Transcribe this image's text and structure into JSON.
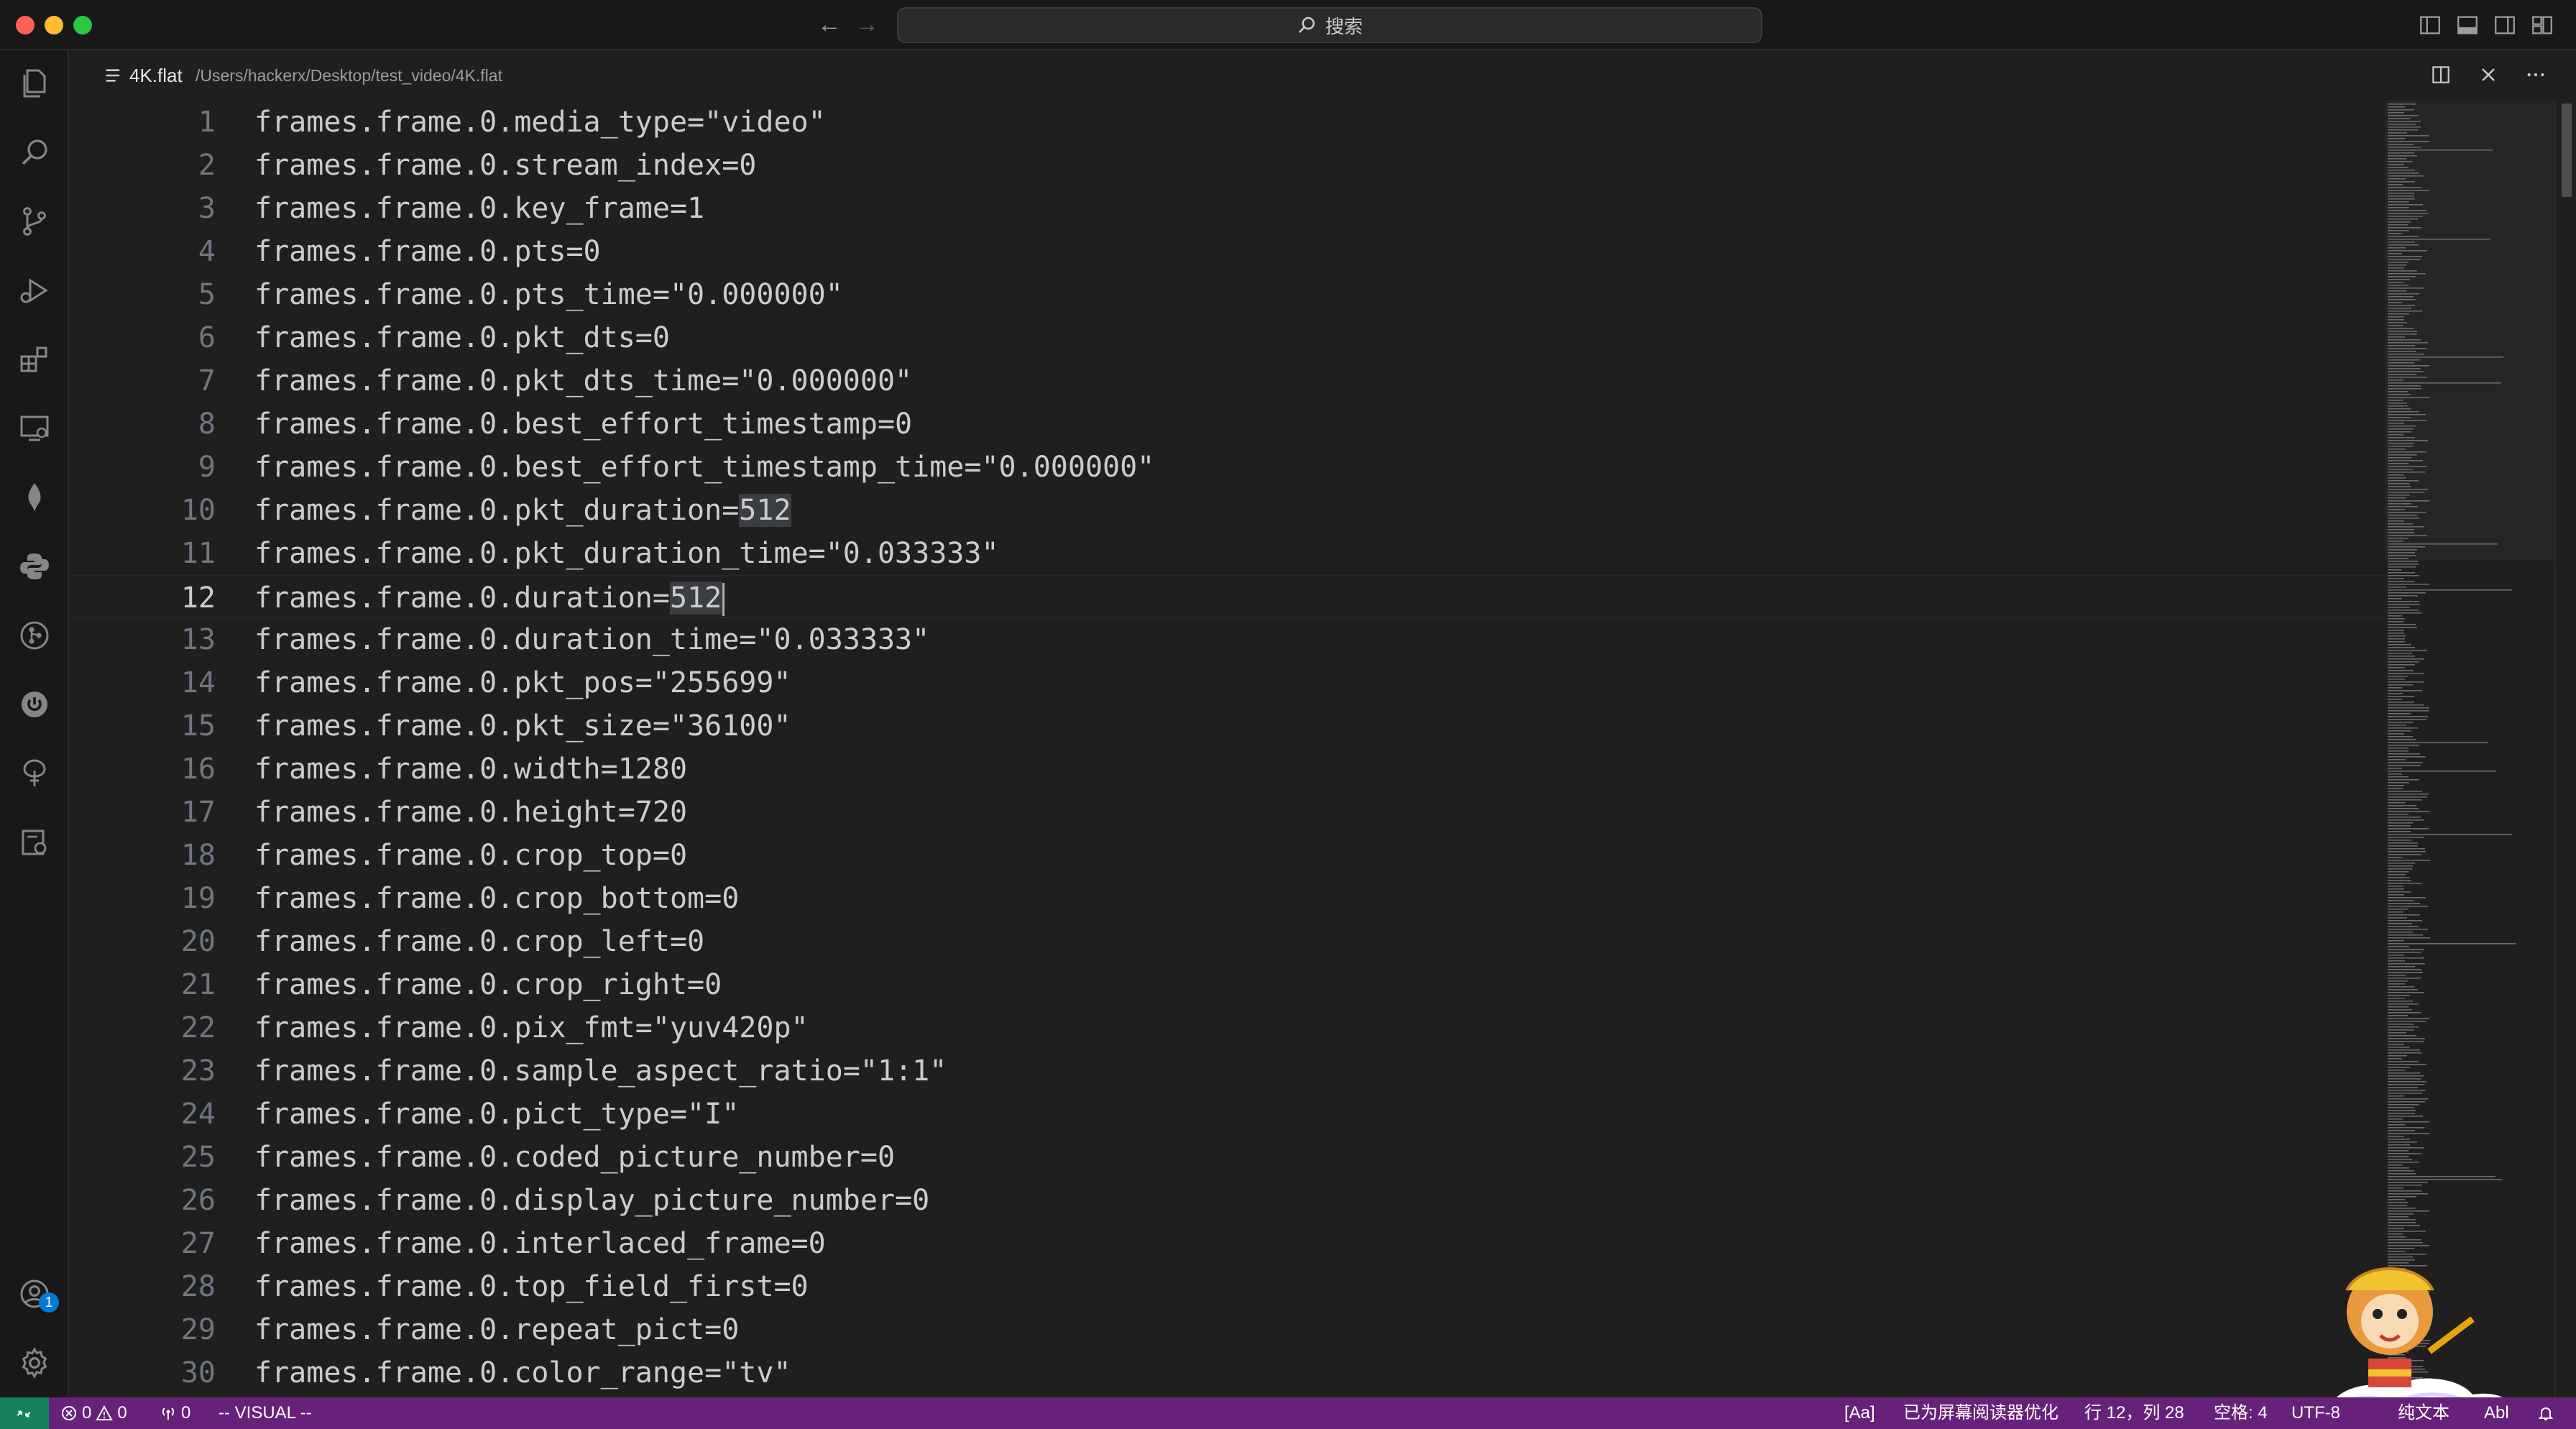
{
  "titlebar": {
    "search_label": "搜索"
  },
  "tab": {
    "file_name": "4K.flat",
    "file_path": "/Users/hackerx/Desktop/test_video/4K.flat"
  },
  "editor": {
    "current_line": 12,
    "lines": [
      {
        "num": "1",
        "text": "frames.frame.0.media_type=\"video\""
      },
      {
        "num": "2",
        "text": "frames.frame.0.stream_index=0"
      },
      {
        "num": "3",
        "text": "frames.frame.0.key_frame=1"
      },
      {
        "num": "4",
        "text": "frames.frame.0.pts=0"
      },
      {
        "num": "5",
        "text": "frames.frame.0.pts_time=\"0.000000\""
      },
      {
        "num": "6",
        "text": "frames.frame.0.pkt_dts=0"
      },
      {
        "num": "7",
        "text": "frames.frame.0.pkt_dts_time=\"0.000000\""
      },
      {
        "num": "8",
        "text": "frames.frame.0.best_effort_timestamp=0"
      },
      {
        "num": "9",
        "text": "frames.frame.0.best_effort_timestamp_time=\"0.000000\""
      },
      {
        "num": "10",
        "text": "frames.frame.0.pkt_duration=",
        "hl": "512"
      },
      {
        "num": "11",
        "text": "frames.frame.0.pkt_duration_time=\"0.033333\""
      },
      {
        "num": "12",
        "text": "frames.frame.0.duration=",
        "hl": "512"
      },
      {
        "num": "13",
        "text": "frames.frame.0.duration_time=\"0.033333\""
      },
      {
        "num": "14",
        "text": "frames.frame.0.pkt_pos=\"255699\""
      },
      {
        "num": "15",
        "text": "frames.frame.0.pkt_size=\"36100\""
      },
      {
        "num": "16",
        "text": "frames.frame.0.width=1280"
      },
      {
        "num": "17",
        "text": "frames.frame.0.height=720"
      },
      {
        "num": "18",
        "text": "frames.frame.0.crop_top=0"
      },
      {
        "num": "19",
        "text": "frames.frame.0.crop_bottom=0"
      },
      {
        "num": "20",
        "text": "frames.frame.0.crop_left=0"
      },
      {
        "num": "21",
        "text": "frames.frame.0.crop_right=0"
      },
      {
        "num": "22",
        "text": "frames.frame.0.pix_fmt=\"yuv420p\""
      },
      {
        "num": "23",
        "text": "frames.frame.0.sample_aspect_ratio=\"1:1\""
      },
      {
        "num": "24",
        "text": "frames.frame.0.pict_type=\"I\""
      },
      {
        "num": "25",
        "text": "frames.frame.0.coded_picture_number=0"
      },
      {
        "num": "26",
        "text": "frames.frame.0.display_picture_number=0"
      },
      {
        "num": "27",
        "text": "frames.frame.0.interlaced_frame=0"
      },
      {
        "num": "28",
        "text": "frames.frame.0.top_field_first=0"
      },
      {
        "num": "29",
        "text": "frames.frame.0.repeat_pict=0"
      },
      {
        "num": "30",
        "text": "frames.frame.0.color_range=\"tv\""
      }
    ]
  },
  "activitybar": {
    "accounts_badge": "1",
    "icons": [
      "explorer-icon",
      "search-icon",
      "source-control-icon",
      "run-debug-icon",
      "extensions-icon",
      "remote-explorer-icon",
      "mongodb-icon",
      "python-icon",
      "gitlens-icon",
      "power-icon",
      "tree-icon",
      "container-icon",
      "accounts-icon",
      "settings-gear-icon"
    ]
  },
  "statusbar": {
    "errors": "0",
    "warnings": "0",
    "ports": "0",
    "vim_mode": "-- VISUAL --",
    "case_toggle": "[Aa]",
    "screen_reader": "已为屏幕阅读器优化",
    "position": "行 12，列 28",
    "spaces": "空格: 4",
    "encoding": "UTF-8",
    "language": "纯文本",
    "spell": "Abl"
  },
  "colors": {
    "statusbar_bg": "#68217a",
    "remote_bg": "#16825d",
    "editor_bg": "#1f1f1f",
    "badge_bg": "#0078d4"
  }
}
